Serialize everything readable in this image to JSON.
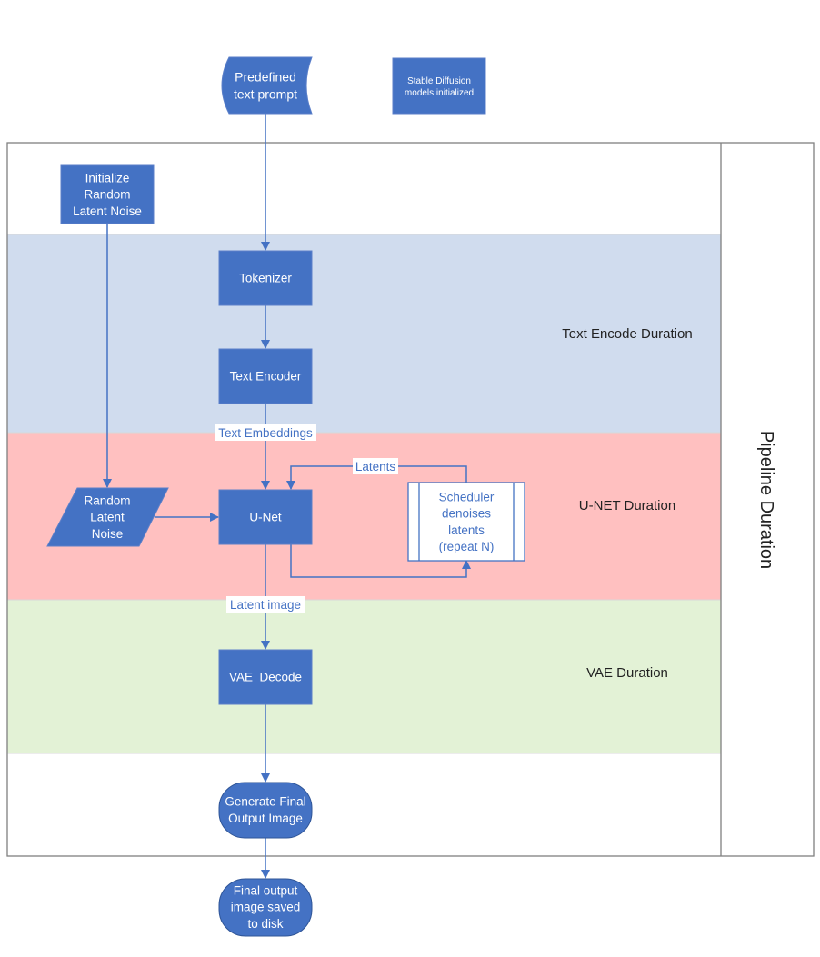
{
  "diagram": {
    "colors": {
      "node_fill": "#4472c4",
      "node_stroke": "#5b7fc9",
      "arrow": "#4472c4",
      "band_text_encode": "#d0dcee",
      "band_unet": "#ffc0c0",
      "band_vae": "#e3f2d6",
      "frame": "#808080",
      "scheduler_fill": "#ffffff",
      "scheduler_text": "#4472c4",
      "band_label_text": "#222222"
    },
    "nodes": {
      "prompt": "Predefined text prompt",
      "models_init": "Stable Diffusion models initialized",
      "init_noise": "Initialize Random Latent Noise",
      "tokenizer": "Tokenizer",
      "text_encoder": "Text Encoder",
      "random_noise": "Random Latent Noise",
      "unet": "U-Net",
      "scheduler": "Scheduler denoises latents (repeat N)",
      "vae_decode": "VAE  Decode",
      "generate_output": "Generate Final Output Image",
      "saved_output": "Final output image saved to disk"
    },
    "node_lines": {
      "prompt": [
        "Predefined",
        "text prompt"
      ],
      "models_init": [
        "Stable Diffusion",
        "models initialized"
      ],
      "init_noise": [
        "Initialize",
        "Random",
        "Latent Noise"
      ],
      "tokenizer": [
        "Tokenizer"
      ],
      "text_encoder": [
        "Text Encoder"
      ],
      "random_noise": [
        "Random",
        "Latent",
        "Noise"
      ],
      "unet": [
        "U-Net"
      ],
      "scheduler": [
        "Scheduler",
        "denoises",
        "latents",
        "(repeat N)"
      ],
      "vae_decode": [
        "VAE  Decode"
      ],
      "generate_output": [
        "Generate Final",
        "Output Image"
      ],
      "saved_output": [
        "Final output",
        "image saved",
        "to disk"
      ]
    },
    "edge_labels": {
      "text_embeddings": "Text Embeddings",
      "latents": "Latents",
      "latent_image": "Latent image"
    },
    "bands": {
      "text_encode": "Text Encode Duration",
      "unet": "U-NET Duration",
      "vae": "VAE Duration",
      "pipeline": "Pipeline Duration"
    }
  }
}
